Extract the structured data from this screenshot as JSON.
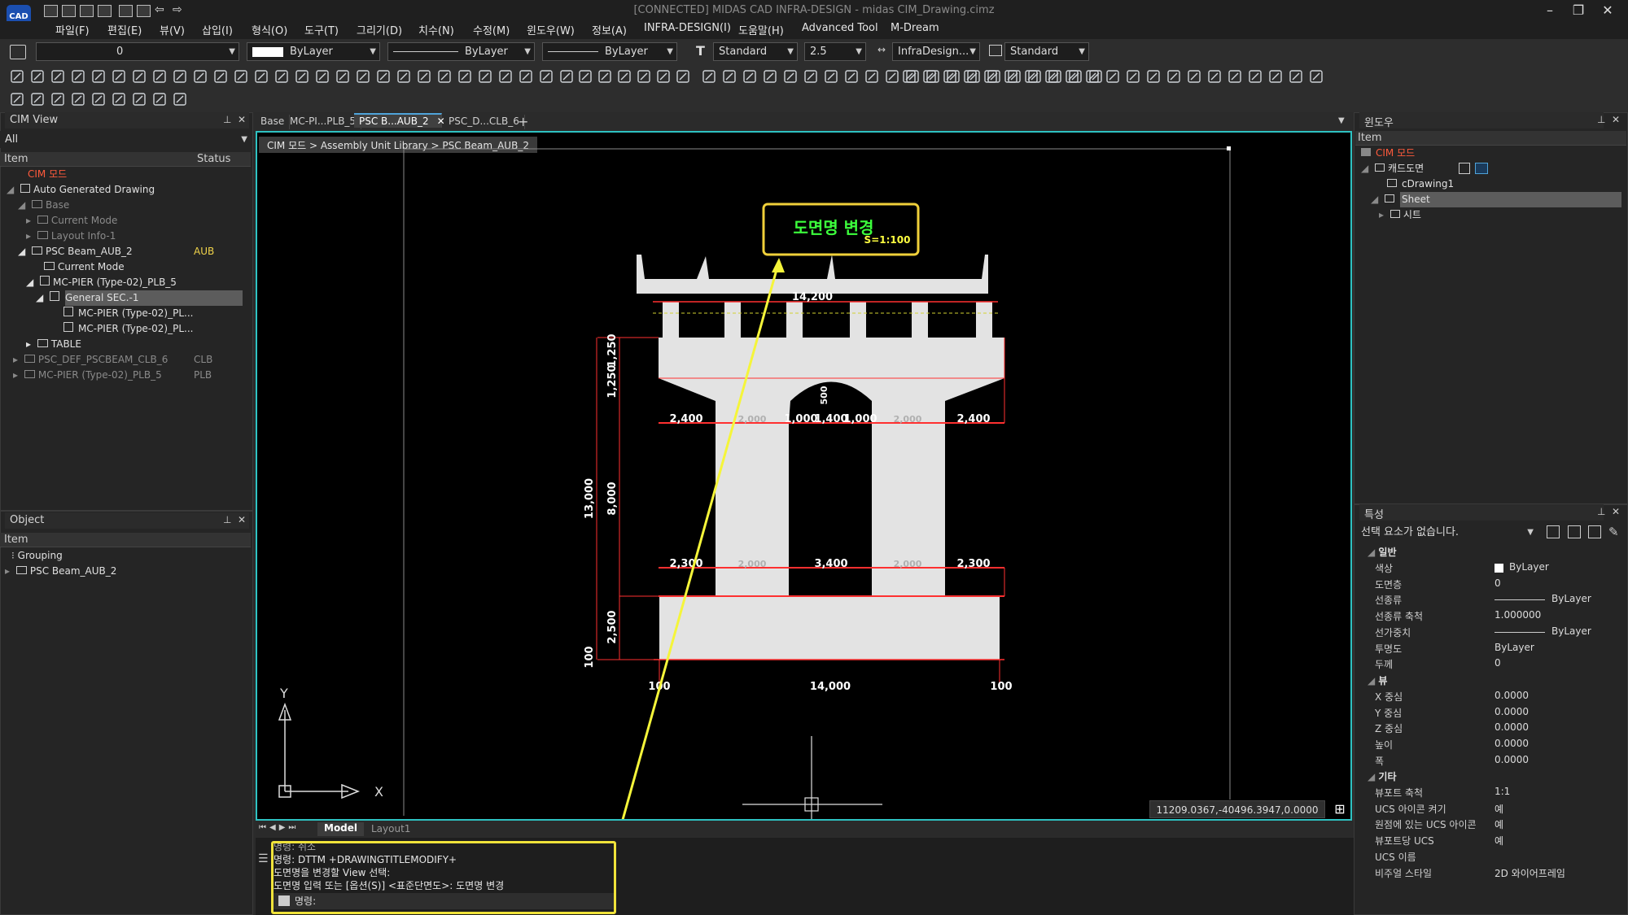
{
  "app": {
    "logo": "CAD",
    "title": "[CONNECTED] MIDAS CAD INFRA-DESIGN - midas CIM_Drawing.cimz"
  },
  "menu": [
    "파일(F)",
    "편집(E)",
    "뷰(V)",
    "삽입(I)",
    "형식(O)",
    "도구(T)",
    "그리기(D)",
    "치수(N)",
    "수정(M)",
    "윈도우(W)",
    "정보(A)",
    "INFRA-DESIGN(I)",
    "도움말(H)",
    "Advanced Tool",
    "M-Dream"
  ],
  "toolbar": {
    "layer": "0",
    "color": "ByLayer",
    "linetype": "ByLayer",
    "lineweight": "ByLayer",
    "textstyle": "Standard",
    "textsize": "2.5",
    "dimstyle": "InfraDesign...",
    "tablestyle": "Standard"
  },
  "cimview": {
    "title": "CIM View",
    "filter": "All",
    "col_item": "Item",
    "col_status": "Status",
    "rows": [
      {
        "label": "CIM 모드",
        "status": ""
      },
      {
        "label": "Auto Generated Drawing",
        "status": ""
      },
      {
        "label": "Base",
        "status": ""
      },
      {
        "label": "Current Mode",
        "status": ""
      },
      {
        "label": "Layout Info-1",
        "status": ""
      },
      {
        "label": "PSC Beam_AUB_2",
        "status": "AUB"
      },
      {
        "label": "Current Mode",
        "status": ""
      },
      {
        "label": "MC-PIER (Type-02)_PLB_5",
        "status": ""
      },
      {
        "label": "General SEC.-1",
        "status": ""
      },
      {
        "label": "MC-PIER (Type-02)_PL...",
        "status": ""
      },
      {
        "label": "MC-PIER (Type-02)_PL...",
        "status": ""
      },
      {
        "label": "TABLE",
        "status": ""
      },
      {
        "label": "PSC_DEF_PSCBEAM_CLB_6",
        "status": "CLB"
      },
      {
        "label": "MC-PIER (Type-02)_PLB_5",
        "status": "PLB"
      }
    ]
  },
  "object": {
    "title": "Object",
    "col_item": "Item",
    "rows": [
      "Grouping",
      "PSC Beam_AUB_2"
    ]
  },
  "doctabs": [
    "Base",
    "MC-PI...PLB_5",
    "PSC B...AUB_2",
    "PSC_D...CLB_6",
    "+"
  ],
  "breadcrumb": "CIM 모드 > Assembly Unit Library > PSC Beam_AUB_2",
  "drawing": {
    "title": "도면명 변경",
    "scale": "S=1:100",
    "dims": {
      "top": "14,200",
      "d1250a": "1,250",
      "d1250b": "1,250",
      "d500": "500",
      "d2400l": "2,400",
      "d2000a": "2,000",
      "d1000a": "1,000",
      "d1400": "1,400",
      "d1000b": "1,000",
      "d2000b": "2,000",
      "d2400r": "2,400",
      "d13000": "13,000",
      "d8000": "8,000",
      "d2300l": "2,300",
      "d2000c": "2,000",
      "d3400": "3,400",
      "d2000d": "2,000",
      "d2300r": "2,300",
      "d2500": "2,500",
      "d100v": "100",
      "d100l": "100",
      "d14000": "14,000",
      "d100r": "100"
    },
    "axis_x": "X",
    "axis_y": "Y"
  },
  "coords": "11209.0367,-40496.3947,0.0000",
  "layouts": [
    "Model",
    "Layout1"
  ],
  "command": {
    "lines": [
      "명령:  취소",
      "명령:  DTTM +DRAWINGTITLEMODIFY+",
      "도면명을 변경할 View 선택:",
      "도면명 입력 또는 [옵션(S)] <표준단면도>: 도면명 변경"
    ],
    "prompt": "명령:"
  },
  "window_panel": {
    "title": "윈도우",
    "col_item": "Item",
    "rows": [
      "CIM 모드",
      "캐드도면",
      "cDrawing1",
      "Sheet",
      "시트"
    ]
  },
  "props": {
    "title": "특성",
    "selection": "선택 요소가 없습니다.",
    "sec_general": "일반",
    "sec_view": "뷰",
    "sec_misc": "기타",
    "general": [
      [
        "색상",
        "ByLayer"
      ],
      [
        "도면층",
        "0"
      ],
      [
        "선종류",
        "ByLayer"
      ],
      [
        "선종류 축척",
        "1.000000"
      ],
      [
        "선가중치",
        "ByLayer"
      ],
      [
        "투명도",
        "ByLayer"
      ],
      [
        "두께",
        "0"
      ]
    ],
    "view": [
      [
        "X 중심",
        "0.0000"
      ],
      [
        "Y 중심",
        "0.0000"
      ],
      [
        "Z 중심",
        "0.0000"
      ],
      [
        "높이",
        "0.0000"
      ],
      [
        "폭",
        "0.0000"
      ]
    ],
    "misc": [
      [
        "뷰포트 축척",
        "1:1"
      ],
      [
        "UCS 아이콘 켜기",
        "예"
      ],
      [
        "원점에 있는 UCS 아이콘",
        "예"
      ],
      [
        "뷰포트당 UCS",
        "예"
      ],
      [
        "UCS 이름",
        ""
      ],
      [
        "비주얼 스타일",
        "2D 와이어프레임"
      ]
    ]
  }
}
